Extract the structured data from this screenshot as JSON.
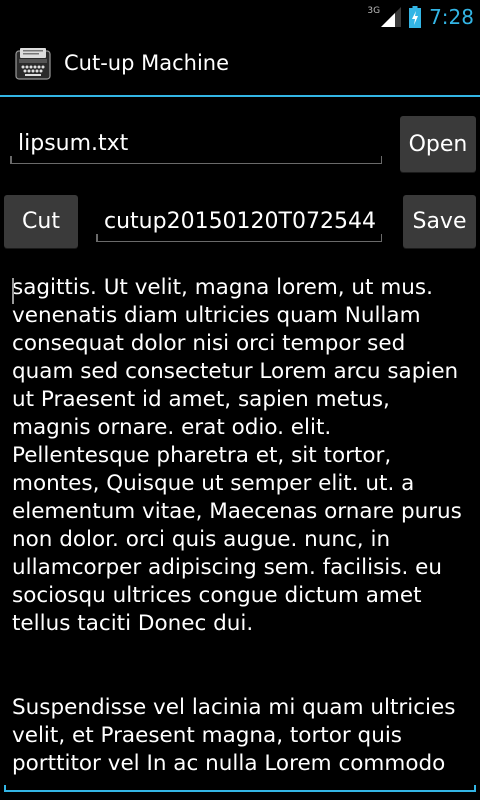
{
  "status_bar": {
    "network": "3G",
    "time": "7:28"
  },
  "action_bar": {
    "title": "Cut-up Machine",
    "icon": "typewriter-icon"
  },
  "file_row": {
    "filename": "lipsum.txt",
    "open_label": "Open"
  },
  "cut_row": {
    "cut_label": "Cut",
    "output_filename": "cutup20150120T072544.",
    "save_label": "Save"
  },
  "content": {
    "paragraph1": "sagittis. Ut velit, magna lorem, ut mus. venenatis diam ultricies quam Nullam consequat dolor nisi orci tempor sed quam sed consectetur Lorem arcu sapien ut Praesent id amet, sapien metus, magnis ornare. erat odio. elit. Pellentesque pharetra et, sit tortor, montes, Quisque ut semper elit. ut. a elementum vitae, Maecenas ornare purus non dolor. orci quis augue. nunc, in ullamcorper adipiscing sem. facilisis. eu sociosqu ultrices congue dictum amet tellus taciti Donec dui.",
    "paragraph2": "Suspendisse vel lacinia mi quam ultricies velit, et Praesent magna, tortor quis porttitor vel In ac nulla Lorem commodo"
  },
  "colors": {
    "accent": "#33b5e5",
    "background": "#000000",
    "button": "#3a3a3a"
  }
}
